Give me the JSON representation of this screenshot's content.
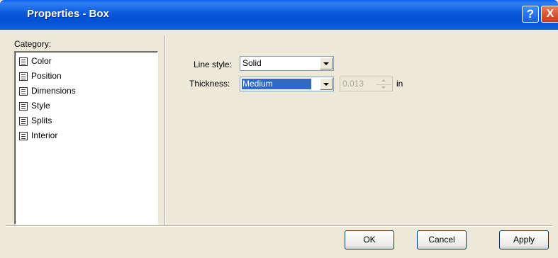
{
  "window": {
    "title": "Properties - Box",
    "help": "?",
    "close": "X"
  },
  "category": {
    "label": "Category:",
    "items": [
      {
        "label": "Color"
      },
      {
        "label": "Position"
      },
      {
        "label": "Dimensions"
      },
      {
        "label": "Style"
      },
      {
        "label": "Splits"
      },
      {
        "label": "Interior"
      }
    ]
  },
  "form": {
    "line_style_label": "Line style:",
    "line_style_value": "Solid",
    "thickness_label": "Thickness:",
    "thickness_value": "Medium",
    "thickness_amount": "0.013",
    "unit": "in"
  },
  "buttons": {
    "ok": "OK",
    "cancel": "Cancel",
    "apply": "Apply"
  }
}
